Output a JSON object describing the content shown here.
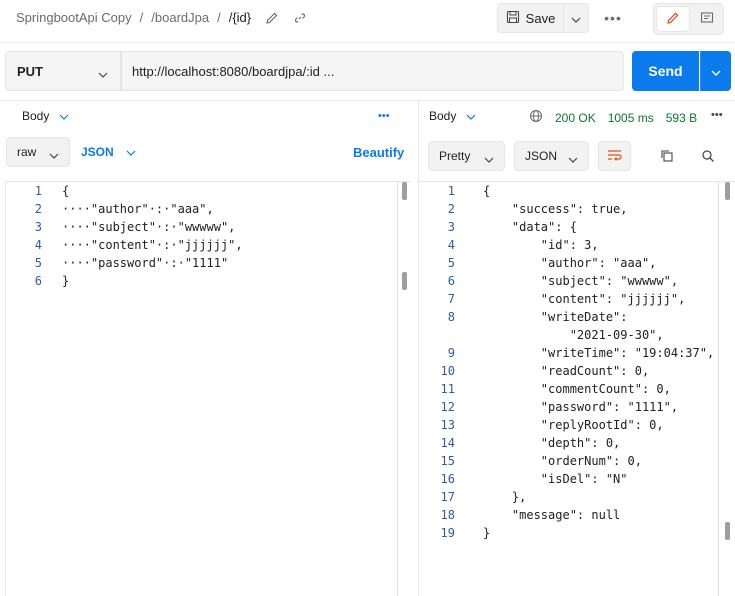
{
  "header": {
    "collection": "SpringbootApi Copy",
    "sep1": "/",
    "folder": "/boardJpa",
    "sep2": "/",
    "request": "/{id}",
    "save_label": "Save",
    "more": "•••"
  },
  "request": {
    "method": "PUT",
    "url": "http://localhost:8080/boardjpa/:id ...",
    "send_label": "Send"
  },
  "left_pane": {
    "tab_label": "Body",
    "more": "•••",
    "mode": "raw",
    "format": "JSON",
    "beautify": "Beautify",
    "line_numbers": [
      "1",
      "2",
      "3",
      "4",
      "5",
      "6"
    ],
    "lines": [
      "{",
      "····\"author\"·:·\"aaa\",",
      "····\"subject\"·:·\"wwwww\",",
      "····\"content\"·:·\"jjjjjj\",",
      "····\"password\"·:·\"1111\"",
      "}"
    ]
  },
  "right_pane": {
    "tab_label": "Body",
    "status": "200 OK",
    "time": "1005 ms",
    "size": "593 B",
    "more": "•••",
    "view": "Pretty",
    "format": "JSON",
    "line_numbers": [
      "1",
      "2",
      "3",
      "4",
      "5",
      "6",
      "7",
      "8",
      "",
      "9",
      "10",
      "11",
      "12",
      "13",
      "14",
      "15",
      "16",
      "17",
      "18",
      "19"
    ],
    "lines": [
      "{",
      "    \"success\": true,",
      "    \"data\": {",
      "        \"id\": 3,",
      "        \"author\": \"aaa\",",
      "        \"subject\": \"wwwww\",",
      "        \"content\": \"jjjjjj\",",
      "        \"writeDate\":",
      "            \"2021-09-30\",",
      "        \"writeTime\": \"19:04:37\",",
      "        \"readCount\": 0,",
      "        \"commentCount\": 0,",
      "        \"password\": \"1111\",",
      "        \"replyRootId\": 0,",
      "        \"depth\": 0,",
      "        \"orderNum\": 0,",
      "        \"isDel\": \"N\"",
      "    },",
      "    \"message\": null",
      "}"
    ]
  },
  "colors": {
    "accent": "#097bed",
    "status_ok": "#0a7a2f",
    "edit_icon": "#e64a19"
  }
}
